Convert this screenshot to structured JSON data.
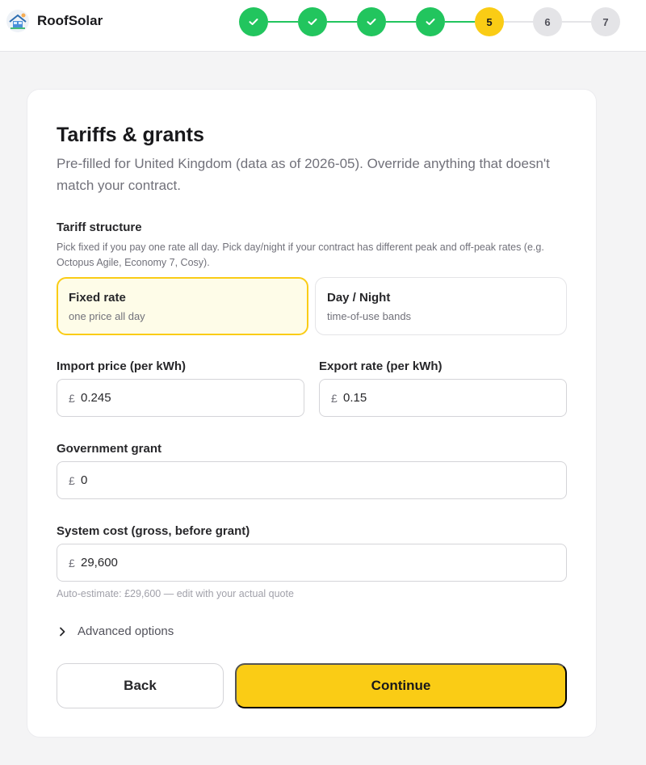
{
  "app": {
    "name": "RoofSolar"
  },
  "stepper": {
    "steps": [
      {
        "state": "done",
        "label": ""
      },
      {
        "state": "done",
        "label": ""
      },
      {
        "state": "done",
        "label": ""
      },
      {
        "state": "done",
        "label": ""
      },
      {
        "state": "current",
        "label": "5"
      },
      {
        "state": "todo",
        "label": "6"
      },
      {
        "state": "todo",
        "label": "7"
      }
    ]
  },
  "page": {
    "title": "Tariffs & grants",
    "subtitle": "Pre-filled for United Kingdom (data as of 2026-05). Override anything that doesn't match your contract."
  },
  "tariff": {
    "label": "Tariff structure",
    "help": "Pick fixed if you pay one rate all day. Pick day/night if your contract has different peak and off-peak rates (e.g. Octopus Agile, Economy 7, Cosy).",
    "options": [
      {
        "title": "Fixed rate",
        "subtitle": "one price all day",
        "selected": true
      },
      {
        "title": "Day / Night",
        "subtitle": "time-of-use bands",
        "selected": false
      }
    ]
  },
  "fields": {
    "import_price": {
      "label": "Import price (per kWh)",
      "currency": "£",
      "value": "0.245"
    },
    "export_rate": {
      "label": "Export rate (per kWh)",
      "currency": "£",
      "value": "0.15"
    },
    "grant": {
      "label": "Government grant",
      "currency": "£",
      "value": "0"
    },
    "system_cost": {
      "label": "System cost (gross, before grant)",
      "currency": "£",
      "value": "29,600",
      "hint": "Auto-estimate: £29,600 — edit with your actual quote"
    }
  },
  "advanced": {
    "label": "Advanced options"
  },
  "actions": {
    "back": "Back",
    "continue": "Continue"
  },
  "colors": {
    "accent": "#facc15",
    "success": "#22c55e",
    "selected_bg": "#fefce8",
    "muted": "#e4e4e7"
  },
  "icons": {
    "logo": "house-solar-logo",
    "done_step": "check-icon",
    "advanced": "chevron-right-icon"
  }
}
